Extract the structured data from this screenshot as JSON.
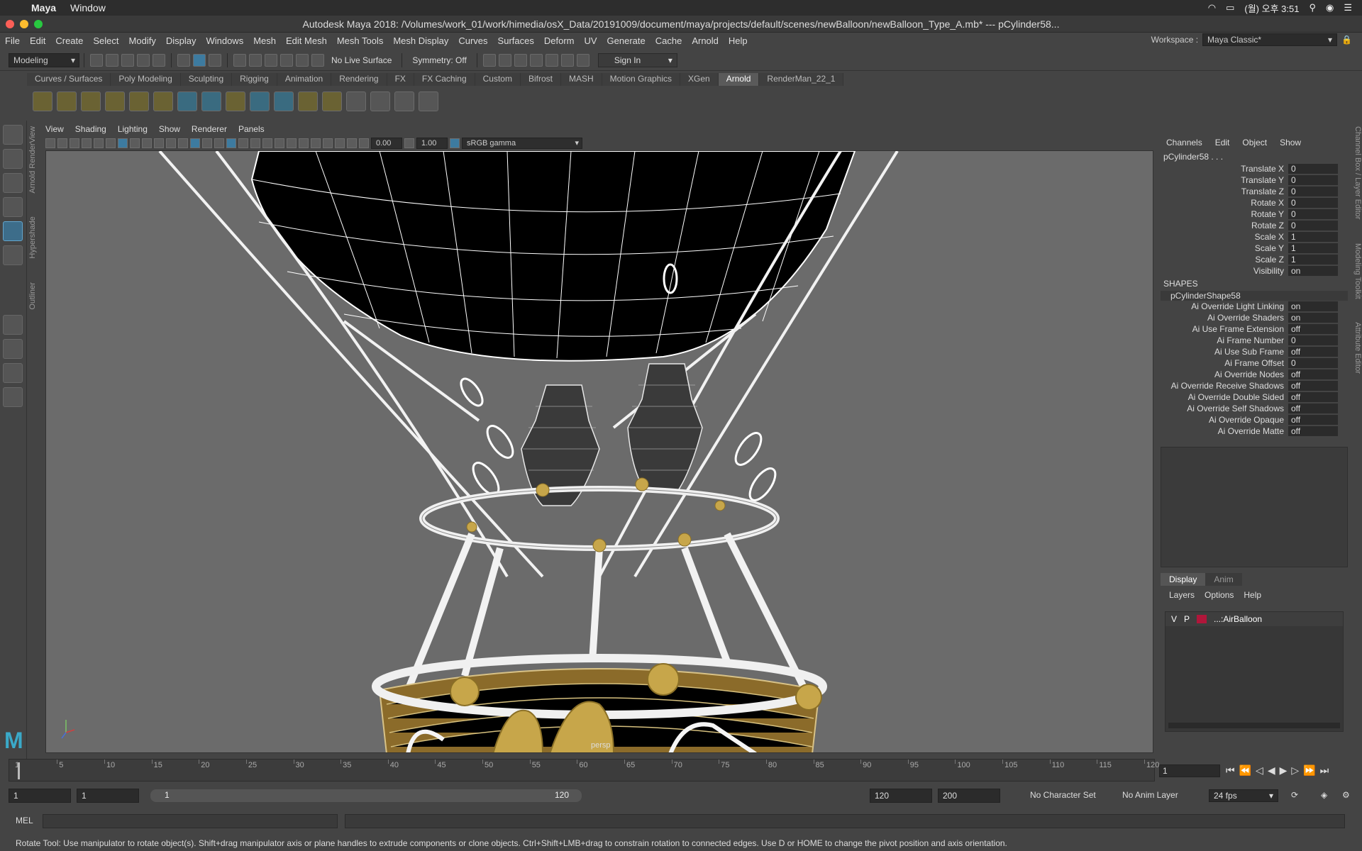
{
  "mac": {
    "app_name": "Maya",
    "menu_window": "Window",
    "clock": "(월) 오후 3:51"
  },
  "title": "Autodesk Maya 2018: /Volumes/work_01/work/himedia/osX_Data/20191009/document/maya/projects/default/scenes/newBalloon/newBalloon_Type_A.mb*   ---   pCylinder58...",
  "menu": [
    "File",
    "Edit",
    "Create",
    "Select",
    "Modify",
    "Display",
    "Windows",
    "Mesh",
    "Edit Mesh",
    "Mesh Tools",
    "Mesh Display",
    "Curves",
    "Surfaces",
    "Deform",
    "UV",
    "Generate",
    "Cache",
    "Arnold",
    "Help"
  ],
  "workspace": {
    "label": "Workspace :",
    "value": "Maya Classic*"
  },
  "status": {
    "mode": "Modeling",
    "live_surface": "No Live Surface",
    "symmetry": "Symmetry: Off",
    "sign_in": "Sign In"
  },
  "shelf_tabs": [
    "Curves / Surfaces",
    "Poly Modeling",
    "Sculpting",
    "Rigging",
    "Animation",
    "Rendering",
    "FX",
    "FX Caching",
    "Custom",
    "Bifrost",
    "MASH",
    "Motion Graphics",
    "XGen",
    "Arnold",
    "RenderMan_22_1"
  ],
  "shelf_active": "Arnold",
  "side_tabs": {
    "outliner": "Outliner",
    "hypershade": "Hypershade",
    "arnold_rv": "Arnold RenderView"
  },
  "panel_menu": [
    "View",
    "Shading",
    "Lighting",
    "Show",
    "Renderer",
    "Panels"
  ],
  "panel_toolbar": {
    "exposure": "0.00",
    "gamma": "1.00",
    "colorspace": "sRGB gamma"
  },
  "viewport": {
    "camera_label": "persp"
  },
  "channel_box": {
    "menu": [
      "Channels",
      "Edit",
      "Object",
      "Show"
    ],
    "object": "pCylinder58 . . .",
    "transforms": [
      {
        "label": "Translate X",
        "value": "0"
      },
      {
        "label": "Translate Y",
        "value": "0"
      },
      {
        "label": "Translate Z",
        "value": "0"
      },
      {
        "label": "Rotate X",
        "value": "0"
      },
      {
        "label": "Rotate Y",
        "value": "0"
      },
      {
        "label": "Rotate Z",
        "value": "0"
      },
      {
        "label": "Scale X",
        "value": "1"
      },
      {
        "label": "Scale Y",
        "value": "1"
      },
      {
        "label": "Scale Z",
        "value": "1"
      },
      {
        "label": "Visibility",
        "value": "on"
      }
    ],
    "shapes_header": "SHAPES",
    "shape_name": "pCylinderShape58",
    "shape_attrs": [
      {
        "label": "Ai Override Light Linking",
        "value": "on"
      },
      {
        "label": "Ai Override Shaders",
        "value": "on"
      },
      {
        "label": "Ai Use Frame Extension",
        "value": "off"
      },
      {
        "label": "Ai Frame Number",
        "value": "0"
      },
      {
        "label": "Ai Use Sub Frame",
        "value": "off"
      },
      {
        "label": "Ai Frame Offset",
        "value": "0"
      },
      {
        "label": "Ai Override Nodes",
        "value": "off"
      },
      {
        "label": "Ai Override Receive Shadows",
        "value": "off"
      },
      {
        "label": "Ai Override Double Sided",
        "value": "off"
      },
      {
        "label": "Ai Override Self Shadows",
        "value": "off"
      },
      {
        "label": "Ai Override Opaque",
        "value": "off"
      },
      {
        "label": "Ai Override Matte",
        "value": "off"
      }
    ]
  },
  "layer_editor": {
    "tabs": [
      "Display",
      "Anim"
    ],
    "menu": [
      "Layers",
      "Options",
      "Help"
    ],
    "layer": {
      "v": "V",
      "p": "P",
      "name": "...:AirBalloon",
      "color": "#b0163a"
    }
  },
  "right_strip": [
    "Channel Box / Layer Editor",
    "Modeling Toolkit",
    "Attribute Editor"
  ],
  "timeline": {
    "ticks": [
      "5",
      "10",
      "15",
      "20",
      "25",
      "30",
      "35",
      "40",
      "45",
      "50",
      "55",
      "60",
      "65",
      "70",
      "75",
      "80",
      "85",
      "90",
      "95",
      "100",
      "105",
      "110",
      "115",
      "120"
    ],
    "current_start": "1",
    "current_frame": "1"
  },
  "range": {
    "start": "1",
    "playback_start": "1",
    "bar_start": "1",
    "bar_end": "120",
    "playback_end": "120",
    "end": "200",
    "character_set": "No Character Set",
    "anim_layer": "No Anim Layer",
    "fps": "24 fps"
  },
  "mel": {
    "label": "MEL"
  },
  "help_line": "Rotate Tool: Use manipulator to rotate object(s). Shift+drag manipulator axis or plane handles to extrude components or clone objects. Ctrl+Shift+LMB+drag to constrain rotation to connected edges. Use D or HOME to change the pivot position and axis orientation."
}
